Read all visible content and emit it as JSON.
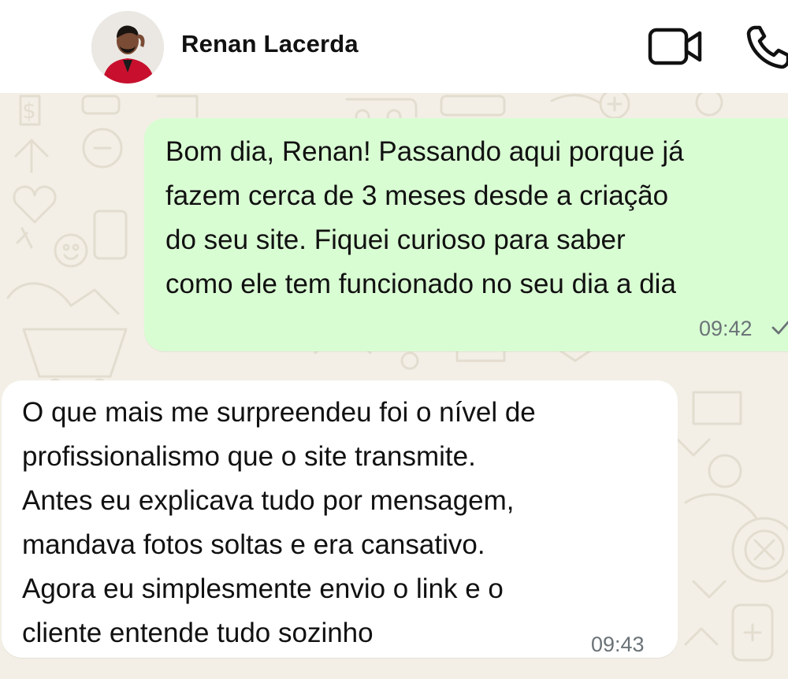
{
  "header": {
    "contact_name": "Renan Lacerda",
    "icons": [
      "avatar-photo",
      "video-call-icon",
      "voice-call-icon"
    ]
  },
  "messages": [
    {
      "direction": "outgoing",
      "text": "Bom dia, Renan! Passando aqui porque já\nfazem cerca de 3 meses desde a criação\ndo seu site. Fiquei curioso para saber\ncomo ele tem funcionado no seu dia a dia",
      "time": "09:42",
      "status_icon": "single-check-icon"
    },
    {
      "direction": "incoming",
      "text": "O que mais me surpreendeu foi o nível de\nprofissionalismo que o site transmite.\nAntes eu explicava tudo por mensagem,\nmandava fotos soltas e era cansativo.\nAgora eu simplesmente envio o link e o\ncliente entende tudo sozinho",
      "time": "09:43"
    }
  ],
  "colors": {
    "chat_background": "#f3efe6",
    "outgoing_bubble": "#d9fdd3",
    "incoming_bubble": "#ffffff",
    "timestamp": "#6b7378"
  }
}
